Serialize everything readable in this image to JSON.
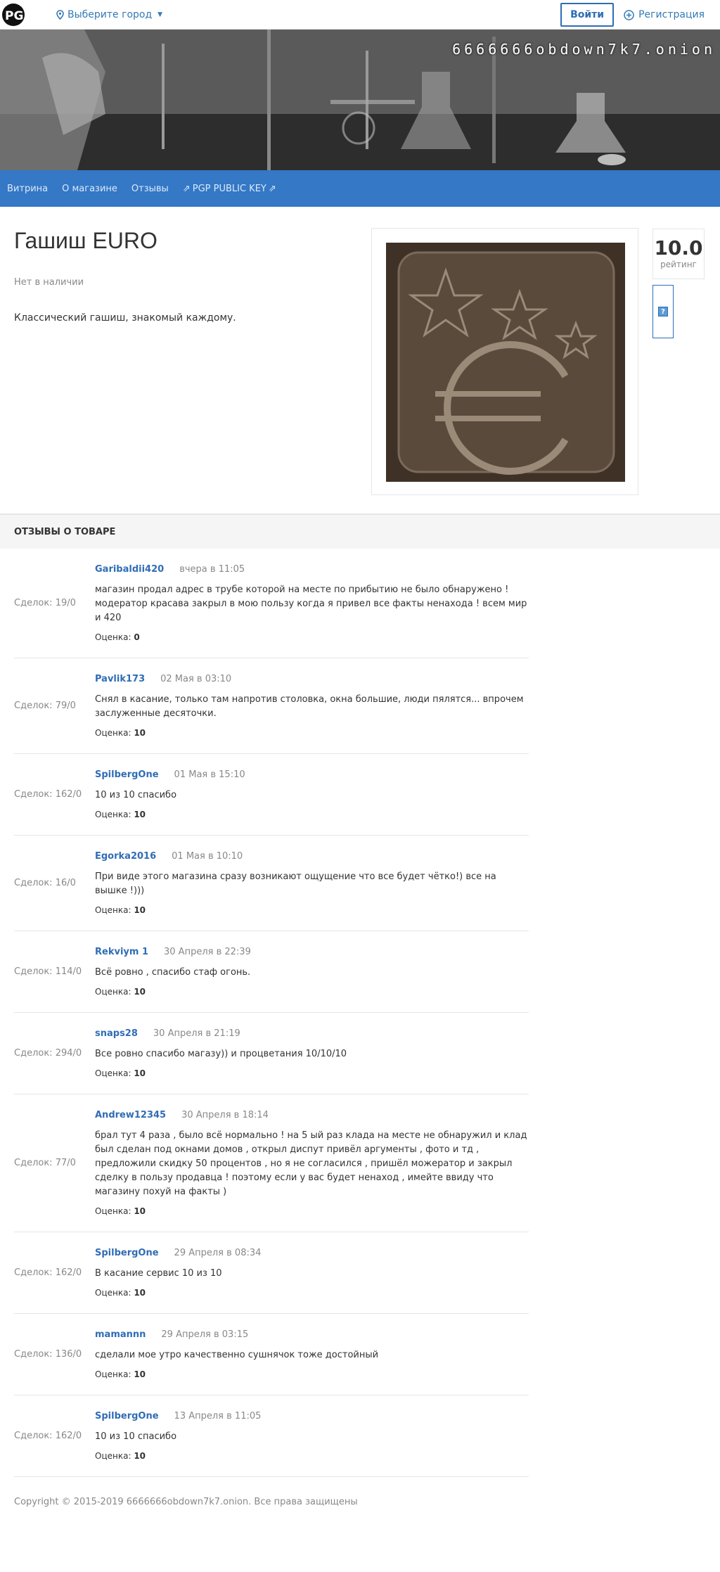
{
  "header": {
    "logo_text": "PG",
    "city_label": "Выберите город",
    "login_label": "Войти",
    "register_label": "Регистрация"
  },
  "banner": {
    "onion": "6666666obdown7k7.onion"
  },
  "nav": [
    {
      "label": "Витрина"
    },
    {
      "label": "О магазине"
    },
    {
      "label": "Отзывы"
    },
    {
      "label": "PGP PUBLIC KEY"
    }
  ],
  "product": {
    "title": "Гашиш EURO",
    "stock": "Нет в наличии",
    "description": "Классический гашиш, знакомый каждому.",
    "rating_value": "10.0",
    "rating_label": "рейтинг"
  },
  "reviews_title": "ОТЗЫВЫ О ТОВАРЕ",
  "reviews": [
    {
      "deals": "Сделок: 19/0",
      "user": "Garibaldii420",
      "date": "вчера в 11:05",
      "text": "магазин продал адрес в трубе которой на месте по прибытию не было обнаружено ! модератор красава закрыл в мою пользу когда я привел все факты ненахода ! всем мир и 420",
      "score_label": "Оценка:",
      "score": "0"
    },
    {
      "deals": "Сделок: 79/0",
      "user": "Pavlik173",
      "date": "02 Мая в 03:10",
      "text": "Снял в касание, только там напротив столовка, окна большие, люди пялятся... впрочем заслуженные десяточки.",
      "score_label": "Оценка:",
      "score": "10"
    },
    {
      "deals": "Сделок: 162/0",
      "user": "SpilbergOne",
      "date": "01 Мая в 15:10",
      "text": "10 из 10 спасибо",
      "score_label": "Оценка:",
      "score": "10"
    },
    {
      "deals": "Сделок: 16/0",
      "user": "Egorka2016",
      "date": "01 Мая в 10:10",
      "text": "При виде этого магазина сразу возникают ощущение что все будет чётко!) все на вышке !)))",
      "score_label": "Оценка:",
      "score": "10"
    },
    {
      "deals": "Сделок: 114/0",
      "user": "Rekviym 1",
      "date": "30 Апреля в 22:39",
      "text": "Всё ровно , спасибо стаф огонь.",
      "score_label": "Оценка:",
      "score": "10"
    },
    {
      "deals": "Сделок: 294/0",
      "user": "snaps28",
      "date": "30 Апреля в 21:19",
      "text": "Все ровно спасибо магазу)) и процветания 10/10/10",
      "score_label": "Оценка:",
      "score": "10"
    },
    {
      "deals": "Сделок: 77/0",
      "user": "Andrew12345",
      "date": "30 Апреля в 18:14",
      "text": "брал тут 4 раза , было всё нормально ! на 5 ый раз клада на месте не обнаружил и клад был сделан под окнами домов , открыл диспут привёл аргументы , фото и тд , предложили скидку 50 процентов , но я не согласился , пришёл можератор и закрыл сделку в пользу продавца ! поэтому если у вас будет ненаход , имейте ввиду что магазину похуй на факты )",
      "score_label": "Оценка:",
      "score": "10"
    },
    {
      "deals": "Сделок: 162/0",
      "user": "SpilbergOne",
      "date": "29 Апреля в 08:34",
      "text": "В касание сервис 10 из 10",
      "score_label": "Оценка:",
      "score": "10"
    },
    {
      "deals": "Сделок: 136/0",
      "user": "mamannn",
      "date": "29 Апреля в 03:15",
      "text": "сделали мое утро качественно сушнячок тоже достойный",
      "score_label": "Оценка:",
      "score": "10"
    },
    {
      "deals": "Сделок: 162/0",
      "user": "SpilbergOne",
      "date": "13 Апреля в 11:05",
      "text": "10 из 10 спасибо",
      "score_label": "Оценка:",
      "score": "10"
    }
  ],
  "footer": {
    "copyright": "Copyright © 2015-2019 6666666obdown7k7.onion. Все права защищены"
  }
}
